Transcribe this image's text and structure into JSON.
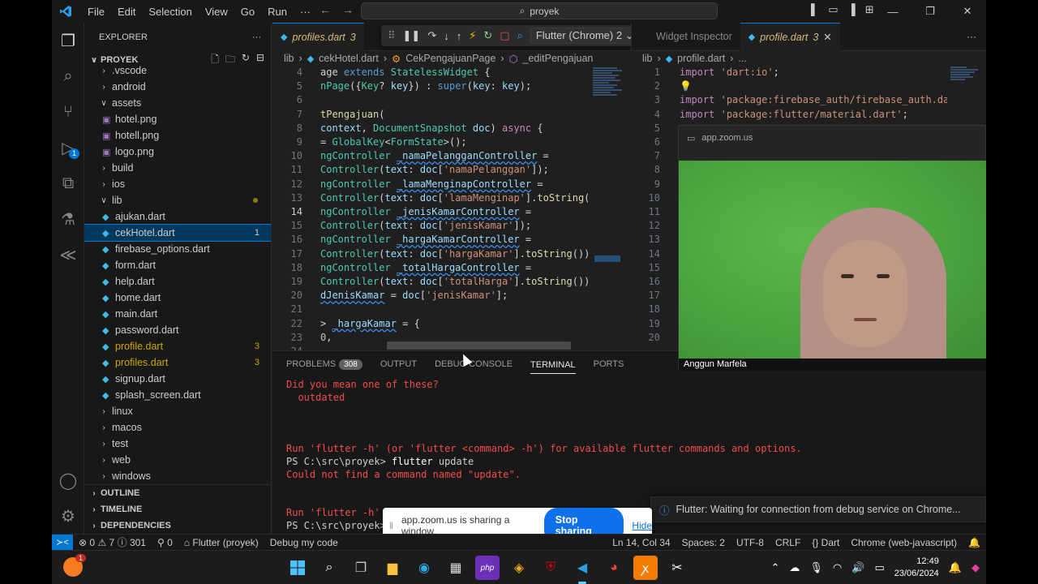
{
  "titlebar": {
    "menu": [
      "File",
      "Edit",
      "Selection",
      "View",
      "Go",
      "Run",
      "···"
    ],
    "search": "proyek"
  },
  "explorer": {
    "title": "EXPLORER",
    "root": "PROYEK",
    "items": [
      {
        "label": ".vscode",
        "type": "folder"
      },
      {
        "label": "android",
        "type": "folder"
      },
      {
        "label": "assets",
        "type": "folder-open"
      },
      {
        "label": "hotel.png",
        "type": "image"
      },
      {
        "label": "hotell.png",
        "type": "image"
      },
      {
        "label": "logo.png",
        "type": "image"
      },
      {
        "label": "build",
        "type": "folder"
      },
      {
        "label": "ios",
        "type": "folder"
      },
      {
        "label": "lib",
        "type": "folder-open"
      },
      {
        "label": "ajukan.dart",
        "type": "dart"
      },
      {
        "label": "cekHotel.dart",
        "type": "dart",
        "count": "1"
      },
      {
        "label": "firebase_options.dart",
        "type": "dart"
      },
      {
        "label": "form.dart",
        "type": "dart"
      },
      {
        "label": "help.dart",
        "type": "dart"
      },
      {
        "label": "home.dart",
        "type": "dart"
      },
      {
        "label": "main.dart",
        "type": "dart"
      },
      {
        "label": "password.dart",
        "type": "dart"
      },
      {
        "label": "profile.dart",
        "type": "dart",
        "count": "3"
      },
      {
        "label": "profiles.dart",
        "type": "dart",
        "count": "3"
      },
      {
        "label": "signup.dart",
        "type": "dart"
      },
      {
        "label": "splash_screen.dart",
        "type": "dart"
      },
      {
        "label": "linux",
        "type": "folder"
      },
      {
        "label": "macos",
        "type": "folder"
      },
      {
        "label": "test",
        "type": "folder"
      },
      {
        "label": "web",
        "type": "folder"
      },
      {
        "label": "windows",
        "type": "folder"
      }
    ],
    "sections": [
      "OUTLINE",
      "TIMELINE",
      "DEPENDENCIES"
    ]
  },
  "editor_left": {
    "tab": "profiles.dart",
    "tab_count": "3",
    "breadcrumb": [
      "lib",
      "cekHotel.dart",
      "CekPengajuanPage",
      "_editPengajuan"
    ],
    "line_numbers": [
      "4",
      "5",
      "6",
      "7",
      "8",
      "9",
      "10",
      "11",
      "12",
      "13",
      "14",
      "15",
      "16",
      "17",
      "18",
      "19",
      "20",
      "21",
      "22",
      "23",
      "24"
    ],
    "current_line": "14"
  },
  "debug_toolbar": {
    "device": "Flutter (Chrome) 2"
  },
  "editor_right": {
    "tab_dim": "Widget Inspector",
    "tab": "profile.dart",
    "tab_count": "3",
    "breadcrumb": [
      "lib",
      "profile.dart",
      "..."
    ],
    "line_numbers": [
      "1",
      "2",
      "3",
      "4",
      "5",
      "6",
      "7",
      "8",
      "9",
      "10",
      "11",
      "12",
      "13",
      "14",
      "15",
      "16",
      "17",
      "18",
      "19",
      "20"
    ]
  },
  "panel": {
    "tabs": [
      "PROBLEMS",
      "OUTPUT",
      "DEBUG CONSOLE",
      "TERMINAL",
      "PORTS"
    ],
    "problems_count": "308",
    "active_tab": "TERMINAL"
  },
  "terminal": {
    "l1": "Did you mean one of these?",
    "l2": "  outdated",
    "l3": "Run 'flutter -h' (or 'flutter <command> -h') for available flutter commands and options.",
    "prompt": "PS C:\\src\\proyek> ",
    "cmd": "flutter",
    "cmd_arg": " update",
    "l5": "Could not find a command named \"update\".",
    "l6": "Run 'flutter -h' (",
    "l7": "PS C:\\src\\proyek> "
  },
  "statusbar": {
    "errors": "0",
    "warnings": "7",
    "infos": "301",
    "ports": "0",
    "flutter": "Flutter (proyek)",
    "debug": "Debug my code",
    "position": "Ln 14, Col 34",
    "spaces": "Spaces: 2",
    "encoding": "UTF-8",
    "eol": "CRLF",
    "language": "Dart",
    "device": "Chrome (web-javascript)"
  },
  "zoom": {
    "window_title": "app.zoom.us",
    "participant": "Anggun Marfela",
    "share_text": "app.zoom.us is sharing a window.",
    "stop_label": "Stop sharing",
    "hide_label": "Hide"
  },
  "notification": {
    "text": "Flutter: Waiting for connection from debug service on Chrome..."
  },
  "taskbar": {
    "time": "12:49",
    "date": "23/06/2024"
  }
}
